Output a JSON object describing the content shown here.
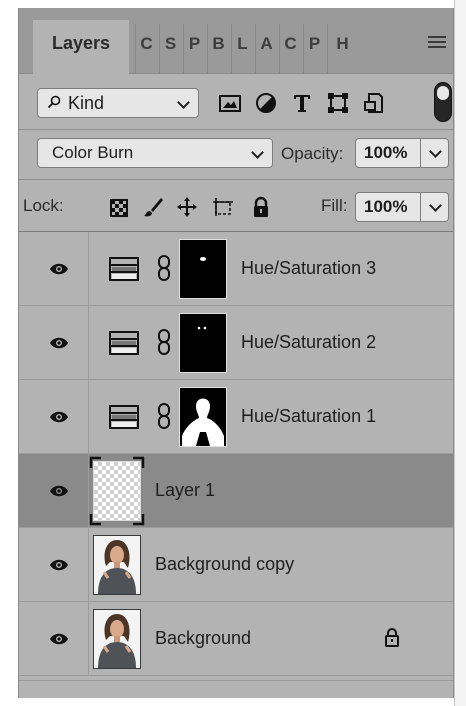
{
  "tabs": {
    "active": "Layers",
    "others": [
      "C",
      "S",
      "P",
      "B",
      "L",
      "A",
      "C",
      "P",
      "H"
    ]
  },
  "filter": {
    "kind_label": "Kind",
    "icons": [
      "image-filter-icon",
      "adjustment-filter-icon",
      "type-filter-icon",
      "shape-filter-icon",
      "smart-object-filter-icon"
    ]
  },
  "blend": {
    "mode": "Color Burn",
    "opacity_label": "Opacity:",
    "opacity_value": "100%"
  },
  "lock": {
    "label": "Lock:",
    "fill_label": "Fill:",
    "fill_value": "100%"
  },
  "layers": [
    {
      "name": "Hue/Saturation 3",
      "type": "adjustment",
      "visible": true
    },
    {
      "name": "Hue/Saturation 2",
      "type": "adjustment",
      "visible": true
    },
    {
      "name": "Hue/Saturation 1",
      "type": "adjustment",
      "visible": true
    },
    {
      "name": "Layer 1",
      "type": "pixel",
      "visible": true,
      "selected": true
    },
    {
      "name": "Background copy",
      "type": "photo",
      "visible": true
    },
    {
      "name": "Background",
      "type": "photo",
      "visible": true,
      "locked": true
    }
  ],
  "colors": {
    "panel": "#b3b3b3",
    "tabbar": "#9a9a9a",
    "selected_row": "#8a8a8a"
  }
}
